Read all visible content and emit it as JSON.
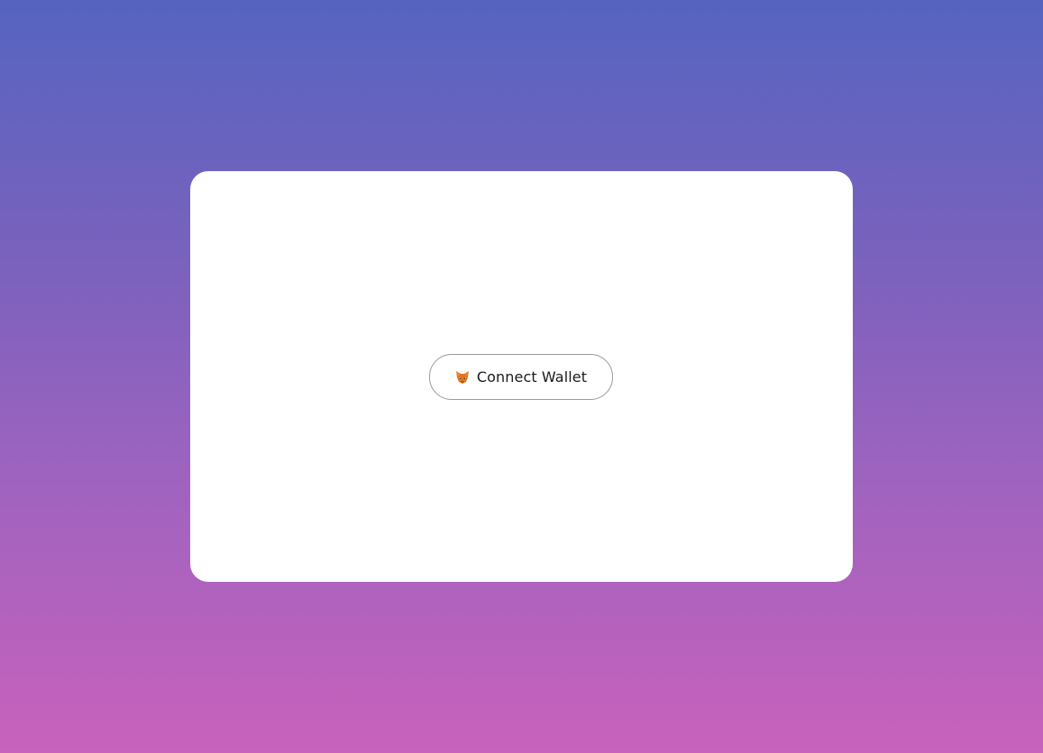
{
  "background": {
    "gradient_top": "#5564c0",
    "gradient_bottom": "#c862bc"
  },
  "card": {
    "color": "#ffffff",
    "connect_button": {
      "label": "Connect Wallet",
      "icon": "fox-icon"
    }
  }
}
